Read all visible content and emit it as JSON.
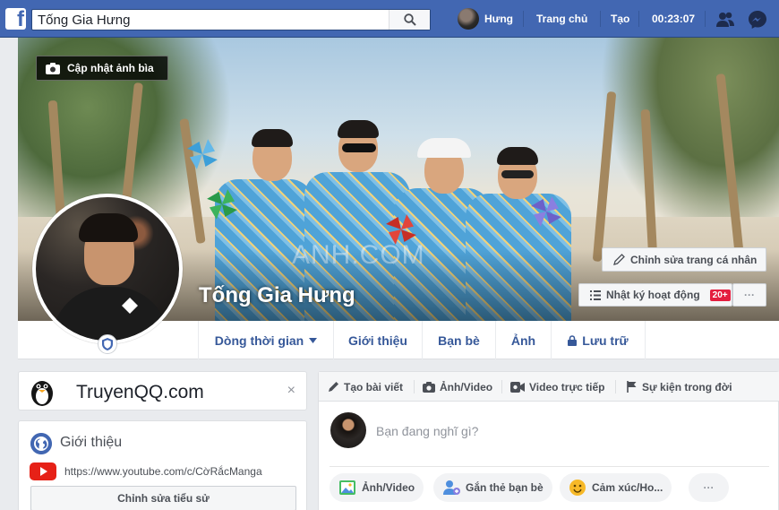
{
  "topbar": {
    "search_value": "Tống Gia Hưng",
    "user_name": "Hưng",
    "home_label": "Trang chủ",
    "create_label": "Tạo",
    "clock": "00:23:07",
    "brand_color": "#4267b2"
  },
  "cover": {
    "update_cover_label": "Cập nhật ảnh bìa",
    "watermark": "ANH.COM"
  },
  "profile": {
    "name": "Tống Gia Hưng",
    "edit_profile_label": "Chỉnh sửa trang cá nhân",
    "activity_log_label": "Nhật ký hoạt động",
    "activity_badge": "20+",
    "more_label": "···"
  },
  "tabs": {
    "items": [
      "Dòng thời gian",
      "Giới thiệu",
      "Bạn bè",
      "Ảnh",
      "Lưu trữ"
    ]
  },
  "ad": {
    "title": "TruyenQQ.com",
    "close": "×"
  },
  "intro": {
    "title": "Giới thiệu",
    "link": "https://www.youtube.com/c/CờRắcManga",
    "edit_bio_label": "Chỉnh sửa tiểu sử"
  },
  "composer": {
    "tabs": [
      "Tạo bài viết",
      "Ảnh/Video",
      "Video trực tiếp",
      "Sự kiện trong đời"
    ],
    "placeholder": "Bạn đang nghĩ gì?",
    "actions": [
      "Ảnh/Video",
      "Gắn thẻ bạn bè",
      "Cảm xúc/Ho...",
      "···"
    ]
  }
}
